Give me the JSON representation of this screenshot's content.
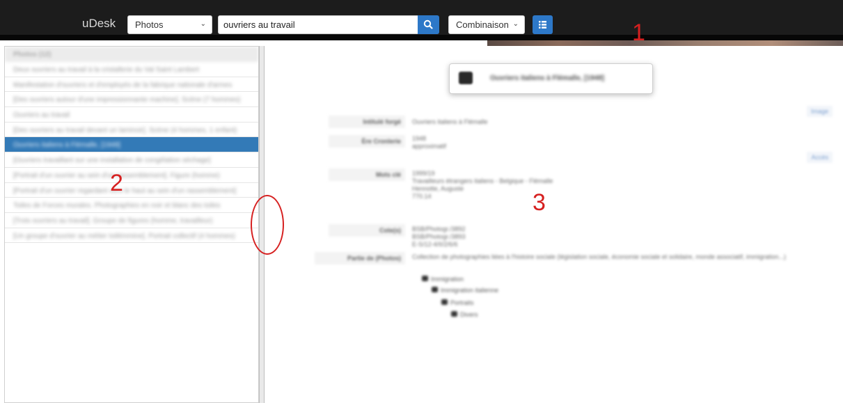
{
  "header": {
    "brand": "uDesk",
    "mode_select": "Photos",
    "search_value": "ouvriers au travail",
    "combination_select": "Combinaison"
  },
  "annotations": {
    "one": "1",
    "two": "2",
    "three": "3"
  },
  "list": {
    "header": "Photos (12)",
    "items": [
      "Deux ouvriers au travail à la cristallerie du Val Saint Lambert",
      "Manifestation d'ouvriers et d'employés de la fabrique nationale d'armes",
      "[Des ouvriers autour d'une impressionnante machine]. Scène (7 hommes)",
      "Ouvriers au travail",
      "[Des ouvriers au travail devant un laminoir]. Scène (4 hommes, 1 enfant)",
      "Ouvriers italiens à Flémalle, [1948]",
      "[Ouvriers travaillant sur une installation de congélation séchage]",
      "[Portrait d'un ouvrier au sein d'un rassemblement]. Figure (homme)",
      "[Portrait d'un ouvrier regardant vers le haut au sein d'un rassemblement]",
      "Toiles de Forces murales. Photographies en noir et blanc des toiles",
      "[Trois ouvriers au travail]. Groupe de figures (homme, travailleur)",
      "[Un groupe d'ouvrier au métier toilémmine]. Portrait collectif (4 hommes)"
    ],
    "selected_index": 5
  },
  "detail": {
    "title": "Ouvriers italiens à Flémalle, [1948]",
    "fields": [
      {
        "label": "Intitulé forgé",
        "value": "Ouvriers italiens à Flémalle"
      },
      {
        "label": "Ère Cronlerie",
        "value": "1948\napproximatif"
      },
      {
        "label": "Mots clé",
        "value": "1999/19\nTravailleurs étrangers italiens - Belgique - Flémalle\nHennotte, Auguste\n770.14"
      },
      {
        "label": "Cote(s)",
        "value": "BSB/Photogr./3892\nBSB/Photogr./3893\nE-S/12-4/II/2/6/6"
      },
      {
        "label": "Partie de (Photos)",
        "value": "Collection de photographies liées à l'histoire sociale (législation sociale, économie sociale et solidaire, monde associatif, immigration...)"
      }
    ],
    "tree": [
      "Immigration",
      "Immigration italienne",
      "Portraits",
      "Divers"
    ],
    "links": {
      "image": "Image",
      "acces": "Accès"
    }
  }
}
